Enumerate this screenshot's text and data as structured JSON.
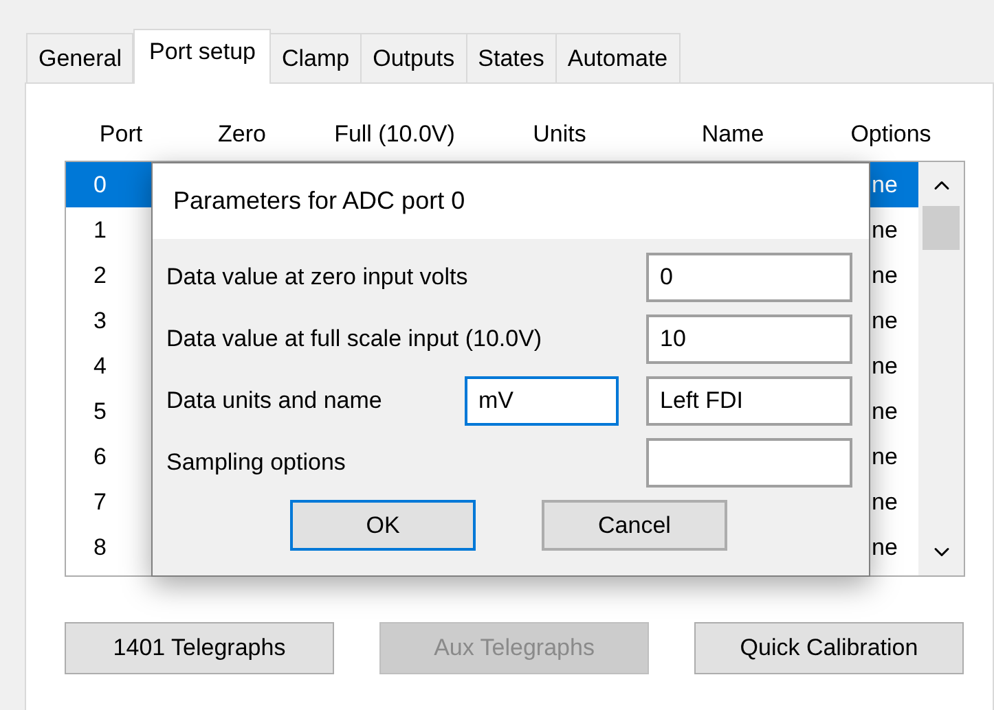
{
  "tabs": [
    {
      "label": "General",
      "selected": false
    },
    {
      "label": "Port setup",
      "selected": true
    },
    {
      "label": "Clamp",
      "selected": false
    },
    {
      "label": "Outputs",
      "selected": false
    },
    {
      "label": "States",
      "selected": false
    },
    {
      "label": "Automate",
      "selected": false
    }
  ],
  "columns": [
    "Port",
    "Zero",
    "Full (10.0V)",
    "Units",
    "Name",
    "Options"
  ],
  "ports": [
    {
      "port": "0",
      "options": "ne",
      "selected": true
    },
    {
      "port": "1",
      "options": "ne",
      "selected": false
    },
    {
      "port": "2",
      "options": "ne",
      "selected": false
    },
    {
      "port": "3",
      "options": "ne",
      "selected": false
    },
    {
      "port": "4",
      "options": "ne",
      "selected": false
    },
    {
      "port": "5",
      "options": "ne",
      "selected": false
    },
    {
      "port": "6",
      "options": "ne",
      "selected": false
    },
    {
      "port": "7",
      "options": "ne",
      "selected": false
    },
    {
      "port": "8",
      "options": "ne",
      "selected": false
    }
  ],
  "dialog": {
    "title": "Parameters for ADC port 0",
    "rows": [
      {
        "label": "Data value at zero input volts",
        "fields": [
          {
            "value": "0",
            "focused": false
          }
        ]
      },
      {
        "label": "Data value at full scale input (10.0V)",
        "fields": [
          {
            "value": "10",
            "focused": false
          }
        ]
      },
      {
        "label": "Data units and name",
        "fields": [
          {
            "value": "mV",
            "focused": true
          },
          {
            "value": "Left FDI",
            "focused": false
          }
        ]
      },
      {
        "label": "Sampling options",
        "fields": [
          {
            "focused": false
          }
        ]
      }
    ],
    "buttons": [
      {
        "label": "OK",
        "default": true
      },
      {
        "label": "Cancel",
        "default": false
      }
    ]
  },
  "buttons": [
    {
      "label": "1401 Telegraphs",
      "disabled": false
    },
    {
      "label": "Aux Telegraphs",
      "disabled": true
    },
    {
      "label": "Quick Calibration",
      "disabled": false
    }
  ]
}
